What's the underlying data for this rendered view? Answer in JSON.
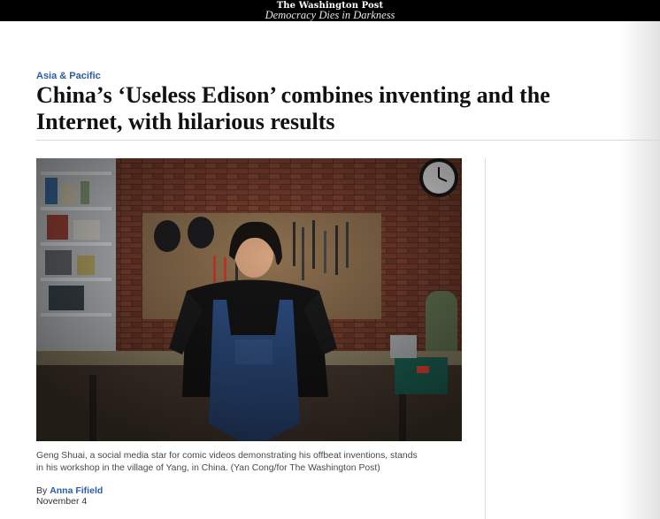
{
  "masthead": {
    "title": "The Washington Post",
    "tagline": "Democracy Dies in Darkness"
  },
  "article": {
    "section": "Asia & Pacific",
    "headline_line1": "China’s ‘Useless Edison’ combines inventing and the",
    "headline_line2": "Internet, with hilarious results",
    "caption_line1": "Geng Shuai, a social media star for comic videos demonstrating his offbeat inventions, stands",
    "caption_line2": "in his workshop in the village of Yang, in China. (Yan Cong/for The Washington Post)",
    "byline_prefix": "By",
    "author": "Anna Fifield",
    "date": "November 4"
  }
}
